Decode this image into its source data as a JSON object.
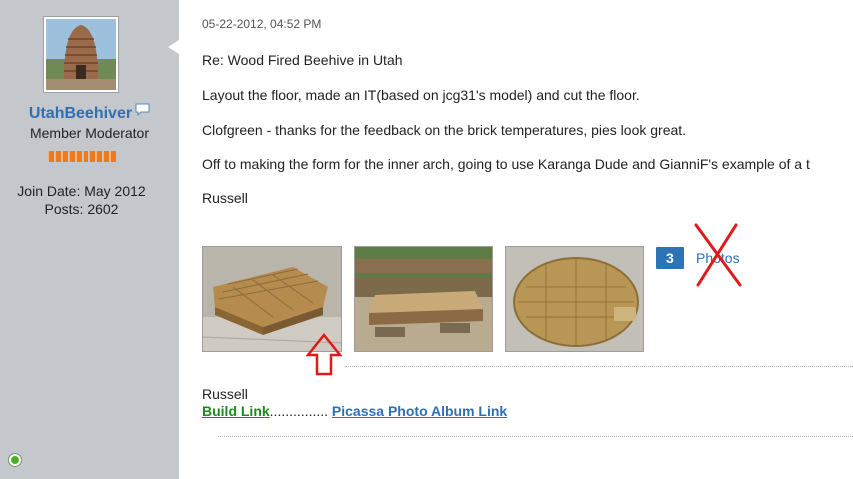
{
  "user": {
    "username": "UtahBeehiver",
    "title": "Member Moderator",
    "join_date": "Join Date: May 2012",
    "posts": "Posts: 2602"
  },
  "post": {
    "date": "05-22-2012, 04:52 PM",
    "title": "Re: Wood Fired Beehive in Utah",
    "lines": [
      "Layout the floor, made an IT(based on jcg31's model) and cut the floor.",
      "Clofgreen - thanks for the feedback on the brick temperatures, pies look great.",
      "Off to making the form for the inner arch, going to use Karanga Dude and GianniF's example of a t",
      "Russell"
    ]
  },
  "photos": {
    "count": "3",
    "label": "Photos"
  },
  "signature": {
    "name": "Russell",
    "build_link": "Build Link",
    "separator": "...............",
    "album_link": "Picassa Photo Album Link"
  },
  "colors": {
    "sidebar_bg": "#c4c8cd",
    "username": "#2f6fb3",
    "reputation": "#f07a1a",
    "badge": "#2e72b8",
    "build_link": "#1d8a1d",
    "annotation_red": "#e0191b",
    "online": "#4caf2a"
  },
  "icons": {
    "chat": "speech-bubble-icon",
    "online": "online-status-icon"
  }
}
